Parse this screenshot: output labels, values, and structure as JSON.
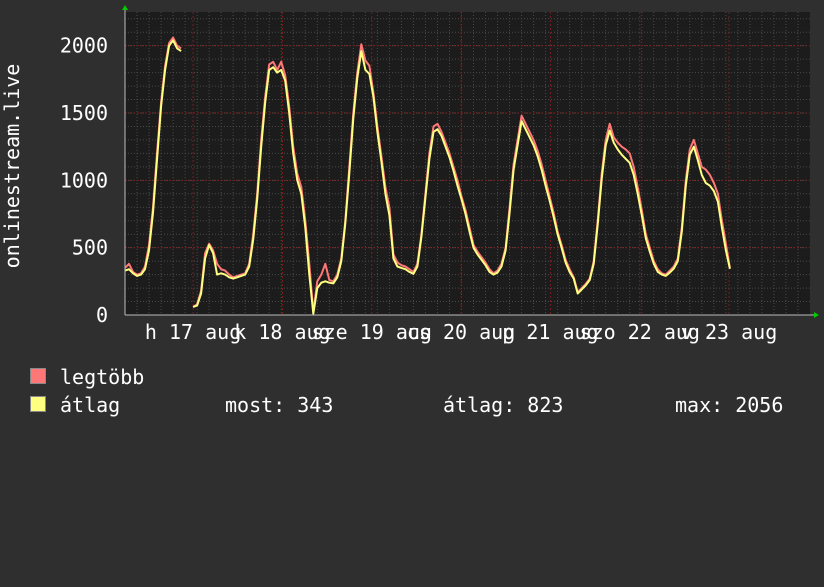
{
  "chart_data": {
    "type": "line",
    "ylabel": "onlinestream.live",
    "ylim": [
      0,
      2250
    ],
    "yticks": [
      0,
      500,
      1000,
      1500,
      2000
    ],
    "grid": true,
    "x_tick_labels": [
      "h 17 aug",
      "k 18 aug",
      "sze 19 aug",
      "cs 20 aug",
      "p 21 aug",
      "szo 22 aug",
      "v 23 aug"
    ],
    "x_range_hours": [
      0,
      171
    ],
    "series": [
      {
        "name": "legtöbb",
        "color": "#ff7777",
        "points": [
          [
            0,
            350
          ],
          [
            1,
            380
          ],
          [
            2,
            320
          ],
          [
            3,
            300
          ],
          [
            4,
            310
          ],
          [
            5,
            360
          ],
          [
            6,
            520
          ],
          [
            7,
            800
          ],
          [
            8,
            1200
          ],
          [
            9,
            1580
          ],
          [
            10,
            1850
          ],
          [
            11,
            2020
          ],
          [
            12,
            2060
          ],
          [
            13,
            2000
          ],
          [
            14,
            1980
          ],
          [
            15,
            null
          ],
          [
            16,
            null
          ],
          [
            17,
            60
          ],
          [
            18,
            80
          ],
          [
            19,
            180
          ],
          [
            20,
            460
          ],
          [
            21,
            530
          ],
          [
            22,
            480
          ],
          [
            23,
            380
          ],
          [
            24,
            340
          ],
          [
            25,
            330
          ],
          [
            26,
            300
          ],
          [
            27,
            280
          ],
          [
            28,
            290
          ],
          [
            29,
            300
          ],
          [
            30,
            310
          ],
          [
            31,
            380
          ],
          [
            32,
            600
          ],
          [
            33,
            900
          ],
          [
            34,
            1300
          ],
          [
            35,
            1620
          ],
          [
            36,
            1860
          ],
          [
            37,
            1880
          ],
          [
            38,
            1820
          ],
          [
            39,
            1880
          ],
          [
            40,
            1780
          ],
          [
            41,
            1550
          ],
          [
            42,
            1250
          ],
          [
            43,
            1050
          ],
          [
            44,
            950
          ],
          [
            45,
            700
          ],
          [
            46,
            380
          ],
          [
            47,
            20
          ],
          [
            48,
            250
          ],
          [
            49,
            300
          ],
          [
            50,
            380
          ],
          [
            51,
            260
          ],
          [
            52,
            250
          ],
          [
            53,
            300
          ],
          [
            54,
            420
          ],
          [
            55,
            700
          ],
          [
            56,
            1100
          ],
          [
            57,
            1500
          ],
          [
            58,
            1800
          ],
          [
            59,
            2010
          ],
          [
            60,
            1890
          ],
          [
            61,
            1850
          ],
          [
            62,
            1650
          ],
          [
            63,
            1400
          ],
          [
            64,
            1180
          ],
          [
            65,
            950
          ],
          [
            66,
            800
          ],
          [
            67,
            450
          ],
          [
            68,
            390
          ],
          [
            69,
            370
          ],
          [
            70,
            360
          ],
          [
            71,
            340
          ],
          [
            72,
            320
          ],
          [
            73,
            380
          ],
          [
            74,
            600
          ],
          [
            75,
            900
          ],
          [
            76,
            1200
          ],
          [
            77,
            1400
          ],
          [
            78,
            1420
          ],
          [
            79,
            1360
          ],
          [
            80,
            1280
          ],
          [
            81,
            1200
          ],
          [
            82,
            1100
          ],
          [
            83,
            1000
          ],
          [
            84,
            880
          ],
          [
            85,
            780
          ],
          [
            86,
            650
          ],
          [
            87,
            520
          ],
          [
            88,
            470
          ],
          [
            89,
            430
          ],
          [
            90,
            390
          ],
          [
            91,
            340
          ],
          [
            92,
            310
          ],
          [
            93,
            330
          ],
          [
            94,
            380
          ],
          [
            95,
            500
          ],
          [
            96,
            800
          ],
          [
            97,
            1120
          ],
          [
            98,
            1300
          ],
          [
            99,
            1480
          ],
          [
            100,
            1420
          ],
          [
            101,
            1360
          ],
          [
            102,
            1300
          ],
          [
            103,
            1220
          ],
          [
            104,
            1120
          ],
          [
            105,
            1000
          ],
          [
            106,
            880
          ],
          [
            107,
            760
          ],
          [
            108,
            620
          ],
          [
            109,
            520
          ],
          [
            110,
            410
          ],
          [
            111,
            340
          ],
          [
            112,
            280
          ],
          [
            113,
            170
          ],
          [
            114,
            200
          ],
          [
            115,
            230
          ],
          [
            116,
            270
          ],
          [
            117,
            400
          ],
          [
            118,
            700
          ],
          [
            119,
            1050
          ],
          [
            120,
            1300
          ],
          [
            121,
            1420
          ],
          [
            122,
            1320
          ],
          [
            123,
            1280
          ],
          [
            124,
            1250
          ],
          [
            125,
            1230
          ],
          [
            126,
            1200
          ],
          [
            127,
            1100
          ],
          [
            128,
            950
          ],
          [
            129,
            780
          ],
          [
            130,
            600
          ],
          [
            131,
            500
          ],
          [
            132,
            400
          ],
          [
            133,
            340
          ],
          [
            134,
            310
          ],
          [
            135,
            300
          ],
          [
            136,
            330
          ],
          [
            137,
            360
          ],
          [
            138,
            420
          ],
          [
            139,
            650
          ],
          [
            140,
            1000
          ],
          [
            141,
            1230
          ],
          [
            142,
            1300
          ],
          [
            143,
            1200
          ],
          [
            144,
            1100
          ],
          [
            145,
            1080
          ],
          [
            146,
            1040
          ],
          [
            147,
            980
          ],
          [
            148,
            900
          ],
          [
            149,
            700
          ],
          [
            150,
            530
          ],
          [
            151,
            350
          ]
        ]
      },
      {
        "name": "átlag",
        "color": "#ffff80",
        "points": [
          [
            0,
            330
          ],
          [
            1,
            340
          ],
          [
            2,
            310
          ],
          [
            3,
            290
          ],
          [
            4,
            300
          ],
          [
            5,
            340
          ],
          [
            6,
            480
          ],
          [
            7,
            760
          ],
          [
            8,
            1150
          ],
          [
            9,
            1550
          ],
          [
            10,
            1820
          ],
          [
            11,
            2000
          ],
          [
            12,
            2040
          ],
          [
            13,
            1980
          ],
          [
            14,
            1960
          ],
          [
            15,
            null
          ],
          [
            16,
            null
          ],
          [
            17,
            60
          ],
          [
            18,
            70
          ],
          [
            19,
            160
          ],
          [
            20,
            420
          ],
          [
            21,
            520
          ],
          [
            22,
            460
          ],
          [
            23,
            300
          ],
          [
            24,
            310
          ],
          [
            25,
            300
          ],
          [
            26,
            280
          ],
          [
            27,
            270
          ],
          [
            28,
            280
          ],
          [
            29,
            290
          ],
          [
            30,
            300
          ],
          [
            31,
            360
          ],
          [
            32,
            560
          ],
          [
            33,
            860
          ],
          [
            34,
            1250
          ],
          [
            35,
            1580
          ],
          [
            36,
            1820
          ],
          [
            37,
            1840
          ],
          [
            38,
            1800
          ],
          [
            39,
            1820
          ],
          [
            40,
            1740
          ],
          [
            41,
            1500
          ],
          [
            42,
            1200
          ],
          [
            43,
            1000
          ],
          [
            44,
            900
          ],
          [
            45,
            650
          ],
          [
            46,
            300
          ],
          [
            47,
            10
          ],
          [
            48,
            200
          ],
          [
            49,
            240
          ],
          [
            50,
            250
          ],
          [
            51,
            240
          ],
          [
            52,
            235
          ],
          [
            53,
            280
          ],
          [
            54,
            400
          ],
          [
            55,
            680
          ],
          [
            56,
            1050
          ],
          [
            57,
            1460
          ],
          [
            58,
            1760
          ],
          [
            59,
            1960
          ],
          [
            60,
            1820
          ],
          [
            61,
            1790
          ],
          [
            62,
            1620
          ],
          [
            63,
            1360
          ],
          [
            64,
            1140
          ],
          [
            65,
            900
          ],
          [
            66,
            740
          ],
          [
            67,
            420
          ],
          [
            68,
            360
          ],
          [
            69,
            350
          ],
          [
            70,
            340
          ],
          [
            71,
            320
          ],
          [
            72,
            305
          ],
          [
            73,
            360
          ],
          [
            74,
            580
          ],
          [
            75,
            870
          ],
          [
            76,
            1160
          ],
          [
            77,
            1360
          ],
          [
            78,
            1380
          ],
          [
            79,
            1330
          ],
          [
            80,
            1250
          ],
          [
            81,
            1170
          ],
          [
            82,
            1070
          ],
          [
            83,
            960
          ],
          [
            84,
            860
          ],
          [
            85,
            750
          ],
          [
            86,
            620
          ],
          [
            87,
            500
          ],
          [
            88,
            450
          ],
          [
            89,
            410
          ],
          [
            90,
            370
          ],
          [
            91,
            320
          ],
          [
            92,
            300
          ],
          [
            93,
            315
          ],
          [
            94,
            360
          ],
          [
            95,
            480
          ],
          [
            96,
            760
          ],
          [
            97,
            1080
          ],
          [
            98,
            1260
          ],
          [
            99,
            1440
          ],
          [
            100,
            1380
          ],
          [
            101,
            1320
          ],
          [
            102,
            1260
          ],
          [
            103,
            1180
          ],
          [
            104,
            1080
          ],
          [
            105,
            960
          ],
          [
            106,
            850
          ],
          [
            107,
            730
          ],
          [
            108,
            600
          ],
          [
            109,
            500
          ],
          [
            110,
            390
          ],
          [
            111,
            320
          ],
          [
            112,
            270
          ],
          [
            113,
            160
          ],
          [
            114,
            190
          ],
          [
            115,
            220
          ],
          [
            116,
            260
          ],
          [
            117,
            380
          ],
          [
            118,
            670
          ],
          [
            119,
            1010
          ],
          [
            120,
            1260
          ],
          [
            121,
            1370
          ],
          [
            122,
            1280
          ],
          [
            123,
            1230
          ],
          [
            124,
            1190
          ],
          [
            125,
            1160
          ],
          [
            126,
            1130
          ],
          [
            127,
            1040
          ],
          [
            128,
            900
          ],
          [
            129,
            740
          ],
          [
            130,
            570
          ],
          [
            131,
            470
          ],
          [
            132,
            380
          ],
          [
            133,
            320
          ],
          [
            134,
            300
          ],
          [
            135,
            290
          ],
          [
            136,
            315
          ],
          [
            137,
            345
          ],
          [
            138,
            400
          ],
          [
            139,
            620
          ],
          [
            140,
            960
          ],
          [
            141,
            1190
          ],
          [
            142,
            1250
          ],
          [
            143,
            1150
          ],
          [
            144,
            1040
          ],
          [
            145,
            980
          ],
          [
            146,
            960
          ],
          [
            147,
            920
          ],
          [
            148,
            840
          ],
          [
            149,
            650
          ],
          [
            150,
            480
          ],
          [
            151,
            343
          ]
        ]
      }
    ]
  },
  "legend": {
    "items": [
      {
        "label": "legtöbb",
        "color": "#ff7777"
      },
      {
        "label": "átlag",
        "color": "#ffff80"
      }
    ],
    "stats": {
      "now": "most: 343",
      "avg": "átlag: 823",
      "max": "max: 2056"
    }
  },
  "colors": {
    "background": "#2f2f2f",
    "plot_background": "#1c1c1c",
    "grid_major": "#7a1e1e",
    "grid_minor": "#4a4a4a",
    "axis": "#bbbbbb",
    "arrow": "#00cc00",
    "text": "#ffffff"
  }
}
